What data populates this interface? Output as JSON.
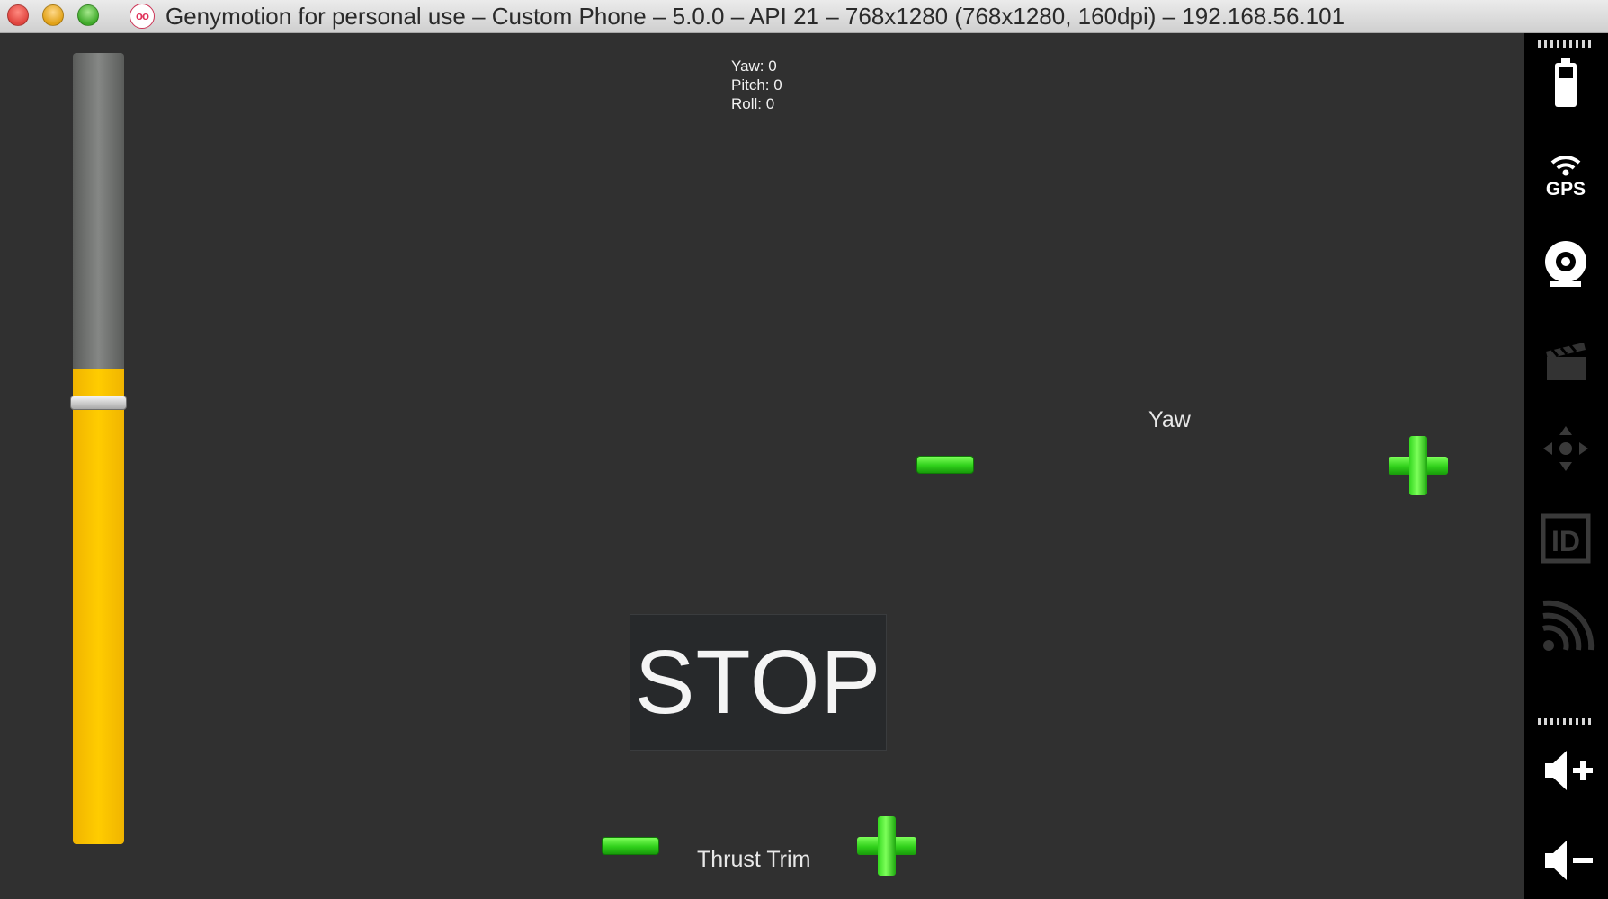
{
  "window": {
    "title": "Genymotion for personal use – Custom Phone – 5.0.0 – API 21 – 768x1280 (768x1280, 160dpi) – 192.168.56.101",
    "logo_text": "oo",
    "traffic_lights": [
      "close",
      "minimize",
      "zoom"
    ]
  },
  "colors": {
    "throttle_fill": "#ffc800",
    "control_green": "#2fd01a",
    "screen_background": "#303030",
    "toolbar_background": "#000000"
  },
  "throttle": {
    "level_percent": 60
  },
  "telemetry": {
    "yaw": "Yaw: 0",
    "pitch": "Pitch: 0",
    "roll": "Roll: 0"
  },
  "yaw_control": {
    "label": "Yaw",
    "minus_icon": "minus-icon",
    "plus_icon": "plus-icon"
  },
  "stop_button": {
    "label": "STOP"
  },
  "thrust_trim": {
    "label": "Thrust Trim",
    "minus_icon": "minus-icon",
    "plus_icon": "plus-icon"
  },
  "toolbar": {
    "items": [
      {
        "icon": "battery-icon"
      },
      {
        "icon": "gps-icon",
        "label": "GPS"
      },
      {
        "icon": "webcam-icon"
      },
      {
        "icon": "clapperboard-icon"
      },
      {
        "icon": "dpad-icon"
      },
      {
        "icon": "id-icon",
        "label": "ID"
      },
      {
        "icon": "rss-icon"
      },
      {
        "icon": "volume-up-icon"
      },
      {
        "icon": "volume-down-icon"
      }
    ]
  }
}
